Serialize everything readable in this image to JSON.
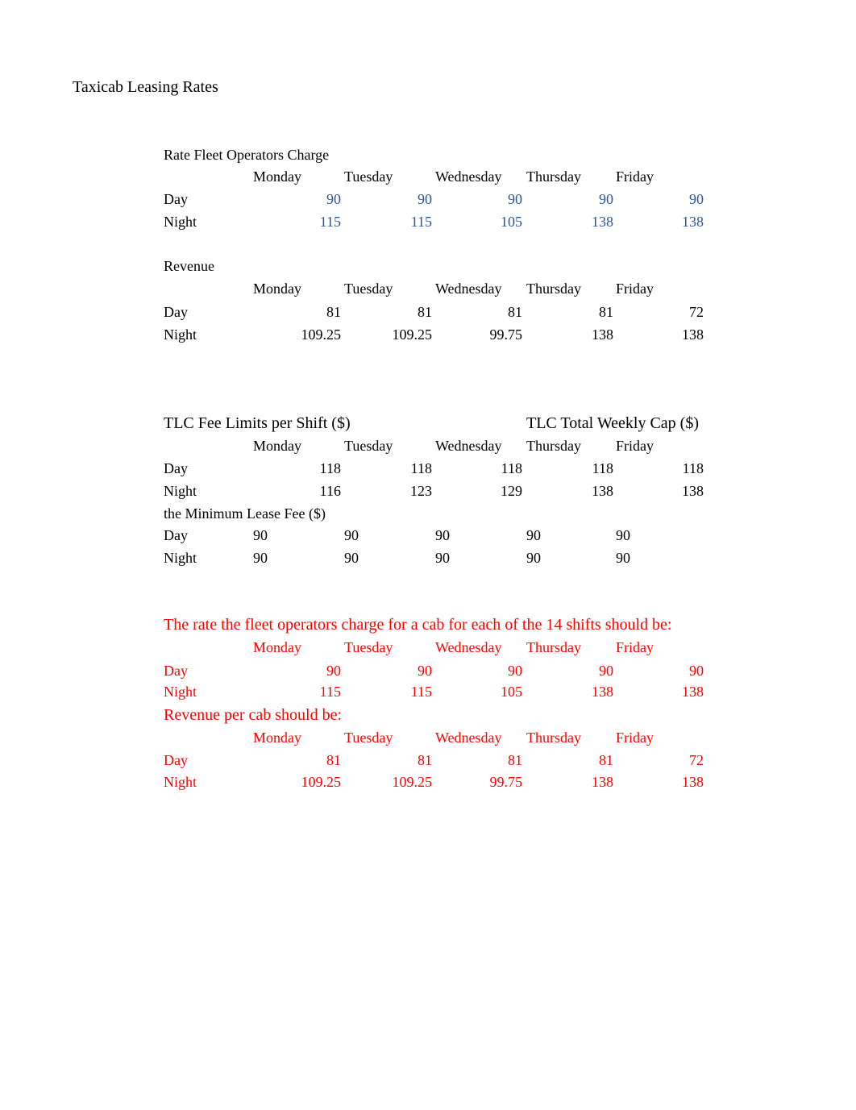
{
  "title": "Taxicab Leasing Rates",
  "days": [
    "Monday",
    "Tuesday",
    "Wednesday",
    "Thursday",
    "Friday"
  ],
  "row_labels": {
    "day": "Day",
    "night": "Night"
  },
  "rate_fleet": {
    "heading": "Rate Fleet Operators Charge",
    "day": [
      "90",
      "90",
      "90",
      "90",
      "90"
    ],
    "night": [
      "115",
      "115",
      "105",
      "138",
      "138"
    ]
  },
  "revenue": {
    "heading": "Revenue",
    "day": [
      "81",
      "81",
      "81",
      "81",
      "72"
    ],
    "night": [
      "109.25",
      "109.25",
      "99.75",
      "138",
      "138"
    ]
  },
  "tlc_limits": {
    "heading": "TLC Fee Limits per Shift ($)",
    "cap_heading": "TLC Total Weekly Cap ($)",
    "day": [
      "118",
      "118",
      "118",
      "118",
      "118"
    ],
    "night": [
      "116",
      "123",
      "129",
      "138",
      "138"
    ]
  },
  "min_lease": {
    "heading": "the Minimum Lease Fee ($)",
    "day": [
      "90",
      "90",
      "90",
      "90",
      "90"
    ],
    "night": [
      "90",
      "90",
      "90",
      "90",
      "90"
    ]
  },
  "answer_rate": {
    "heading": "The rate the fleet operators charge for a cab for each of the 14 shifts should be:",
    "day": [
      "90",
      "90",
      "90",
      "90",
      "90"
    ],
    "night": [
      "115",
      "115",
      "105",
      "138",
      "138"
    ]
  },
  "answer_revenue": {
    "heading": "Revenue per cab should be:",
    "day": [
      "81",
      "81",
      "81",
      "81",
      "72"
    ],
    "night": [
      "109.25",
      "109.25",
      "99.75",
      "138",
      "138"
    ]
  },
  "colors": {
    "input_blue": "#2f5597",
    "answer_red": "#ff0000"
  }
}
